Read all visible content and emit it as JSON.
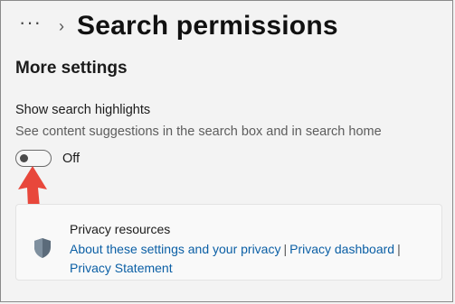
{
  "header": {
    "more_label": "···",
    "chevron": "›",
    "title": "Search permissions"
  },
  "section": {
    "title": "More settings"
  },
  "setting": {
    "label": "Show search highlights",
    "description": "See content suggestions in the search box and in search home",
    "toggle_state": "Off",
    "toggle_on": false
  },
  "privacy": {
    "title": "Privacy resources",
    "links": [
      "About these settings and your privacy",
      "Privacy dashboard",
      "Privacy Statement"
    ],
    "separator": "|"
  },
  "colors": {
    "link": "#0b5fa5",
    "arrow": "#e8473b",
    "background": "#f3f3f3"
  },
  "icons": [
    "more-icon",
    "chevron-right-icon",
    "shield-icon",
    "pointer-arrow-icon"
  ]
}
